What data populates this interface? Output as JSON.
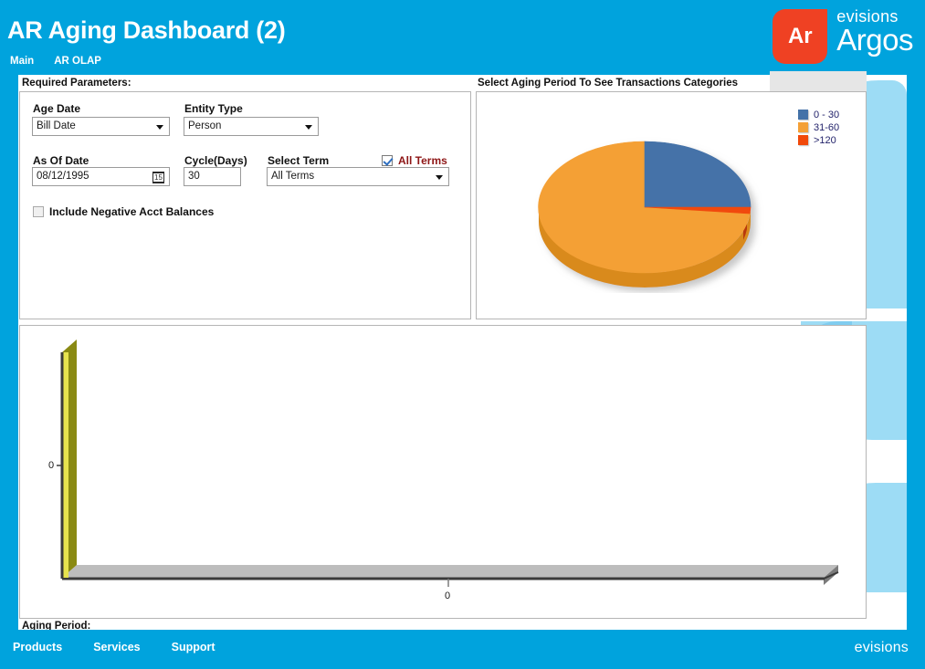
{
  "header": {
    "title": "AR Aging Dashboard (2)",
    "nav": [
      {
        "label": "Main"
      },
      {
        "label": "AR OLAP"
      }
    ],
    "logo": {
      "mark": "Ar",
      "brand_small": "evisions",
      "brand_large": "Argos"
    }
  },
  "params": {
    "section_label": "Required Parameters:",
    "age_date": {
      "label": "Age Date",
      "value": "Bill Date",
      "options": [
        "Bill Date"
      ]
    },
    "entity_type": {
      "label": "Entity Type",
      "value": "Person",
      "options": [
        "Person"
      ]
    },
    "as_of_date": {
      "label": "As Of Date",
      "value": "08/12/1995",
      "calendar_icon_text": "15"
    },
    "cycle_days": {
      "label": "Cycle(Days)",
      "value": "30"
    },
    "select_term": {
      "label": "Select Term",
      "value": "All Terms",
      "options": [
        "All Terms"
      ]
    },
    "all_terms": {
      "label": "All Terms",
      "checked": true
    },
    "include_negative": {
      "label": "Include Negative Acct Balances",
      "checked": false
    }
  },
  "aging": {
    "section_label": "Select Aging Period To See Transactions Categories"
  },
  "bar_section": {
    "footer_label": "Aging Period:"
  },
  "footer": {
    "nav": [
      {
        "label": "Products"
      },
      {
        "label": "Services"
      },
      {
        "label": "Support"
      }
    ],
    "brand": "evisions"
  },
  "colors": {
    "brand_blue": "#00a3dd",
    "logo_red": "#ef4123",
    "pie_blue": "#4472a8",
    "pie_orange": "#f5a githu",
    "pie_orange_fix": "#f4a036",
    "pie_red": "#f1490a",
    "wall_olive": "#8a8a13",
    "floor_grey": "#bdbdbd"
  },
  "chart_data": [
    {
      "type": "pie",
      "title": "Select Aging Period To See Transactions Categories",
      "legend_position": "right",
      "labels": [
        "0 - 30",
        "31-60",
        ">120"
      ],
      "values": [
        22,
        76,
        2
      ],
      "unit": "percent",
      "colors": [
        "#4472a8",
        "#f4a036",
        "#f1490a"
      ],
      "three_d": true
    },
    {
      "type": "bar",
      "title": "",
      "xlabel": "Aging Period:",
      "ylabel": "",
      "categories": [
        "0"
      ],
      "values": [
        0
      ],
      "xticks": [
        "0"
      ],
      "yticks": [
        "0"
      ],
      "ylim": [
        0,
        0
      ],
      "grid": false,
      "three_d": true,
      "note": "empty 3-D bar chart; no data plotted"
    }
  ]
}
